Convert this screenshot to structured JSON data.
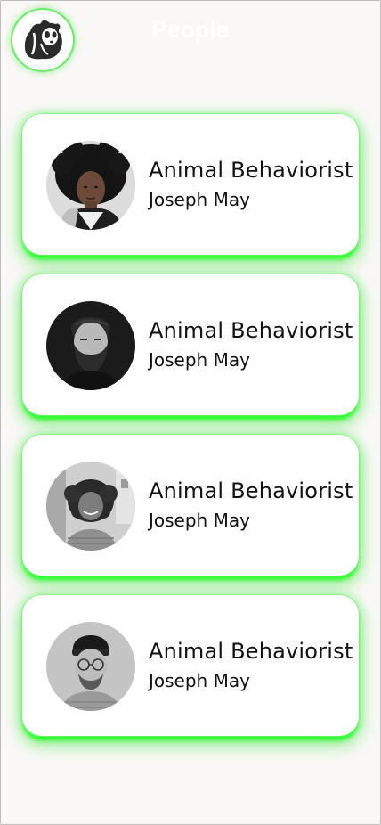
{
  "header": {
    "title": "People",
    "logo_icon": "panda-icon"
  },
  "people": [
    {
      "role": "Animal Behaviorist",
      "name": "Joseph May",
      "avatar": "woman-curly-hair-avatar"
    },
    {
      "role": "Animal Behaviorist",
      "name": "Joseph May",
      "avatar": "man-beard-avatar"
    },
    {
      "role": "Animal Behaviorist",
      "name": "Joseph May",
      "avatar": "woman-smiling-avatar"
    },
    {
      "role": "Animal Behaviorist",
      "name": "Joseph May",
      "avatar": "man-beanie-glasses-avatar"
    }
  ],
  "colors": {
    "accent_glow": "#2cff2c",
    "background": "#f9f8f6",
    "card": "#ffffff"
  }
}
